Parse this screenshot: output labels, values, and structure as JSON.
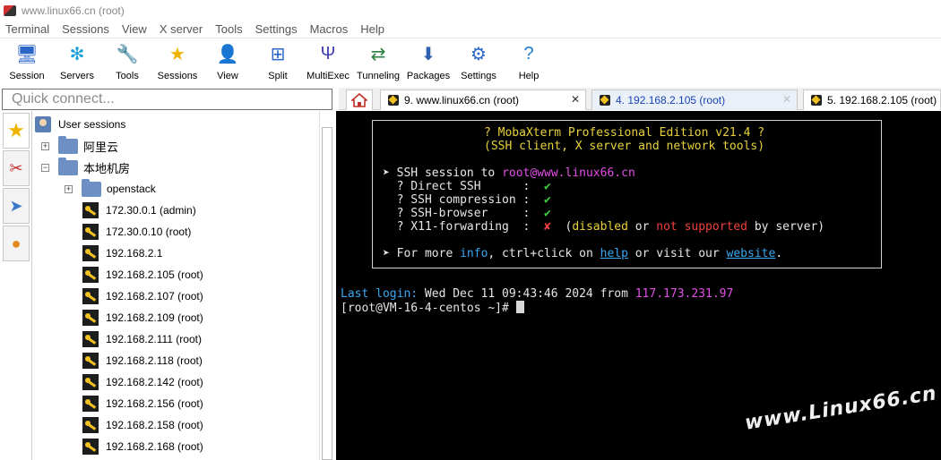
{
  "window": {
    "title": "www.linux66.cn (root)"
  },
  "menu": [
    "Terminal",
    "Sessions",
    "View",
    "X server",
    "Tools",
    "Settings",
    "Macros",
    "Help"
  ],
  "toolbar": [
    {
      "label": "Session",
      "icon": "session-icon",
      "glyph": "🖥",
      "color": "#2a66c8"
    },
    {
      "label": "Servers",
      "icon": "servers-icon",
      "glyph": "✻",
      "color": "#1aa0d8"
    },
    {
      "label": "Tools",
      "icon": "tools-icon",
      "glyph": "🔧",
      "color": "#c83030"
    },
    {
      "label": "Sessions",
      "icon": "sessions-star-icon",
      "glyph": "★",
      "color": "#f0b400"
    },
    {
      "label": "View",
      "icon": "view-icon",
      "glyph": "👤",
      "color": "#2a8040"
    },
    {
      "label": "Split",
      "icon": "split-icon",
      "glyph": "⊞",
      "color": "#2a66c8"
    },
    {
      "label": "MultiExec",
      "icon": "multiexec-icon",
      "glyph": "Ψ",
      "color": "#4040b0"
    },
    {
      "label": "Tunneling",
      "icon": "tunneling-icon",
      "glyph": "⇄",
      "color": "#2a8040"
    },
    {
      "label": "Packages",
      "icon": "packages-icon",
      "glyph": "⬇",
      "color": "#3060b0"
    },
    {
      "label": "Settings",
      "icon": "settings-icon",
      "glyph": "⚙",
      "color": "#2a66c8"
    },
    {
      "label": "Help",
      "icon": "help-icon",
      "glyph": "?",
      "color": "#1a7fd8"
    }
  ],
  "quick_connect": {
    "placeholder": "Quick connect..."
  },
  "tabs": [
    {
      "label": "9. www.linux66.cn (root)",
      "active": true
    },
    {
      "label": "4. 192.168.2.105 (root)",
      "active": false
    },
    {
      "label": "5. 192.168.2.105 (root)",
      "active": false
    }
  ],
  "sessions": {
    "root_label": "User sessions",
    "folders": [
      {
        "label": "阿里云",
        "expander": "+"
      },
      {
        "label": "本地机房",
        "expander": "−"
      },
      {
        "label": "openstack",
        "expander": "+"
      }
    ],
    "items": [
      "172.30.0.1 (admin)",
      "172.30.0.10 (root)",
      "192.168.2.1",
      "192.168.2.105 (root)",
      "192.168.2.107 (root)",
      "192.168.2.109 (root)",
      "192.168.2.111 (root)",
      "192.168.2.118 (root)",
      "192.168.2.142 (root)",
      "192.168.2.156 (root)",
      "192.168.2.158 (root)",
      "192.168.2.168 (root)"
    ]
  },
  "terminal": {
    "banner_title": "? MobaXterm Professional Edition v21.4 ?",
    "banner_subtitle": "(SSH client, X server and network tools)",
    "session_prefix": "➤ SSH session to ",
    "session_target": "root@www.linux66.cn",
    "checks": [
      {
        "label": "  ? Direct SSH      :  ",
        "mark": "✔"
      },
      {
        "label": "  ? SSH compression :  ",
        "mark": "✔"
      },
      {
        "label": "  ? SSH-browser     :  ",
        "mark": "✔"
      }
    ],
    "x11_label": "  ? X11-forwarding  :  ",
    "x11_mark": "✘",
    "x11_paren_open": "  (",
    "x11_disabled": "disabled",
    "x11_or": " or ",
    "x11_not_supported": "not supported",
    "x11_by_server": " by server)",
    "more_prefix": "➤ For more ",
    "more_info": "info",
    "more_mid": ", ctrl+click on ",
    "more_help": "help",
    "more_visit": " or visit our ",
    "more_website": "website",
    "more_end": ".",
    "last_login_label": "Last login:",
    "last_login_date": " Wed Dec 11 09:43:46 2024 from ",
    "last_login_ip": "117.173.231.97",
    "prompt": "[root@VM-16-4-centos ~]# ",
    "watermark": "www.Linux66.cn"
  }
}
